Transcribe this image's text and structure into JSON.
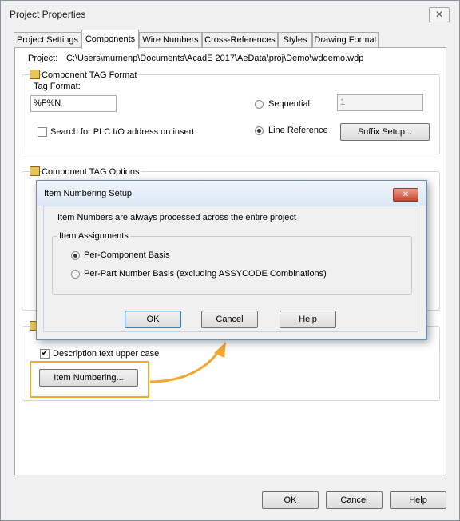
{
  "window": {
    "title": "Project Properties",
    "close_glyph": "✕"
  },
  "tabs": [
    {
      "label": "Project Settings"
    },
    {
      "label": "Components"
    },
    {
      "label": "Wire Numbers"
    },
    {
      "label": "Cross-References"
    },
    {
      "label": "Styles"
    },
    {
      "label": "Drawing Format"
    }
  ],
  "project": {
    "label": "Project:",
    "path": "C:\\Users\\murnenp\\Documents\\AcadE 2017\\AeData\\proj\\Demo\\wddemo.wdp"
  },
  "tag_format_group": {
    "title": "Component TAG Format",
    "tag_format_label": "Tag Format:",
    "tag_format_value": "%F%N",
    "sequential_label": "Sequential:",
    "sequential_value": "1",
    "plc_checkbox_label": "Search for PLC I/O address on insert",
    "line_reference_label": "Line Reference",
    "suffix_setup_label": "Suffix Setup..."
  },
  "tag_options_group": {
    "title": "Component TAG Options"
  },
  "bottom_group": {
    "description_upper_label": "Description text upper case",
    "item_numbering_label": "Item Numbering..."
  },
  "dialog": {
    "title": "Item Numbering Setup",
    "close_glyph": "✕",
    "info_text": "Item Numbers are always processed across the entire project",
    "assignments_title": "Item Assignments",
    "per_component_label": "Per-Component Basis",
    "per_part_label": "Per-Part Number Basis (excluding ASSYCODE Combinations)",
    "ok_label": "OK",
    "cancel_label": "Cancel",
    "help_label": "Help"
  },
  "footer": {
    "ok_label": "OK",
    "cancel_label": "Cancel",
    "help_label": "Help"
  },
  "colors": {
    "highlight": "#f0a830",
    "arrow": "#f0a830"
  }
}
